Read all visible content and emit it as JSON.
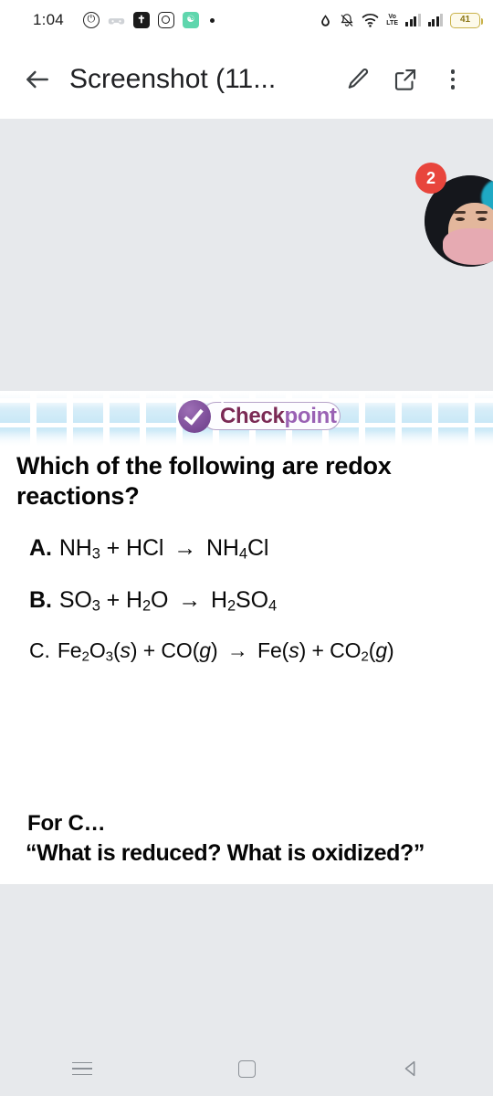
{
  "statusbar": {
    "time": "1:04",
    "left_icons": [
      {
        "name": "messenger-icon",
        "glyph": "~"
      },
      {
        "name": "game-controller-icon",
        "glyph": ""
      },
      {
        "name": "bible-app-icon",
        "glyph": "✝"
      },
      {
        "name": "instagram-icon",
        "glyph": ""
      },
      {
        "name": "green-app-icon",
        "glyph": "☗"
      },
      {
        "name": "more-notifications-dot",
        "glyph": ""
      }
    ],
    "right_icons": [
      {
        "name": "water-drop-icon"
      },
      {
        "name": "notifications-muted-icon"
      },
      {
        "name": "wifi-icon"
      },
      {
        "name": "volte-icon",
        "line1": "Vo",
        "line2": "LTE"
      },
      {
        "name": "signal-sim1-icon"
      },
      {
        "name": "signal-sim2-icon"
      }
    ],
    "battery_level": "41"
  },
  "appbar": {
    "back_label": "←",
    "title": "Screenshot (11...",
    "edit_icon": "pencil-icon",
    "share_icon": "share-icon",
    "overflow_icon": "overflow-menu-icon"
  },
  "viewer": {
    "avatar_badge_count": "2",
    "avatar_name": "profile-avatar"
  },
  "slide": {
    "checkpoint": {
      "text_part1": "Check",
      "text_part2": "point",
      "color_part1": "#7b2a55",
      "color_part2": "#9a62b4",
      "circle_color": "#7e4f9a"
    },
    "question": "Which of the following are redox reactions?",
    "options": [
      {
        "label": "A.",
        "plain": "NH3 + HCl → NH4Cl",
        "parts": [
          {
            "t": "NH"
          },
          {
            "t": "3",
            "sub": true
          },
          {
            "t": " + HCl "
          },
          {
            "t": "→",
            "arrow": true
          },
          {
            "t": " NH"
          },
          {
            "t": "4",
            "sub": true
          },
          {
            "t": "Cl"
          }
        ]
      },
      {
        "label": "B.",
        "plain": "SO3 + H2O → H2SO4",
        "parts": [
          {
            "t": "SO"
          },
          {
            "t": "3",
            "sub": true
          },
          {
            "t": " + H"
          },
          {
            "t": "2",
            "sub": true
          },
          {
            "t": "O "
          },
          {
            "t": "→",
            "arrow": true
          },
          {
            "t": " H"
          },
          {
            "t": "2",
            "sub": true
          },
          {
            "t": "SO"
          },
          {
            "t": "4",
            "sub": true
          }
        ]
      },
      {
        "label": "C.",
        "plain": "Fe2O3(s) + CO(g) → Fe(s) + CO2(g)",
        "parts": [
          {
            "t": "Fe"
          },
          {
            "t": "2",
            "sub": true
          },
          {
            "t": "O"
          },
          {
            "t": "3",
            "sub": true
          },
          {
            "t": "("
          },
          {
            "t": "s",
            "italic": true
          },
          {
            "t": ") + CO("
          },
          {
            "t": "g",
            "italic": true
          },
          {
            "t": ") "
          },
          {
            "t": "→",
            "arrow": true
          },
          {
            "t": " Fe("
          },
          {
            "t": "s",
            "italic": true
          },
          {
            "t": ") + CO"
          },
          {
            "t": "2",
            "sub": true
          },
          {
            "t": "("
          },
          {
            "t": "g",
            "italic": true
          },
          {
            "t": ")"
          }
        ]
      }
    ],
    "for_c": "For C…",
    "prompt": "“What is reduced? What is oxidized?”"
  },
  "navbar": {
    "recents_label": "recent-apps",
    "home_label": "home",
    "back_label": "back"
  }
}
